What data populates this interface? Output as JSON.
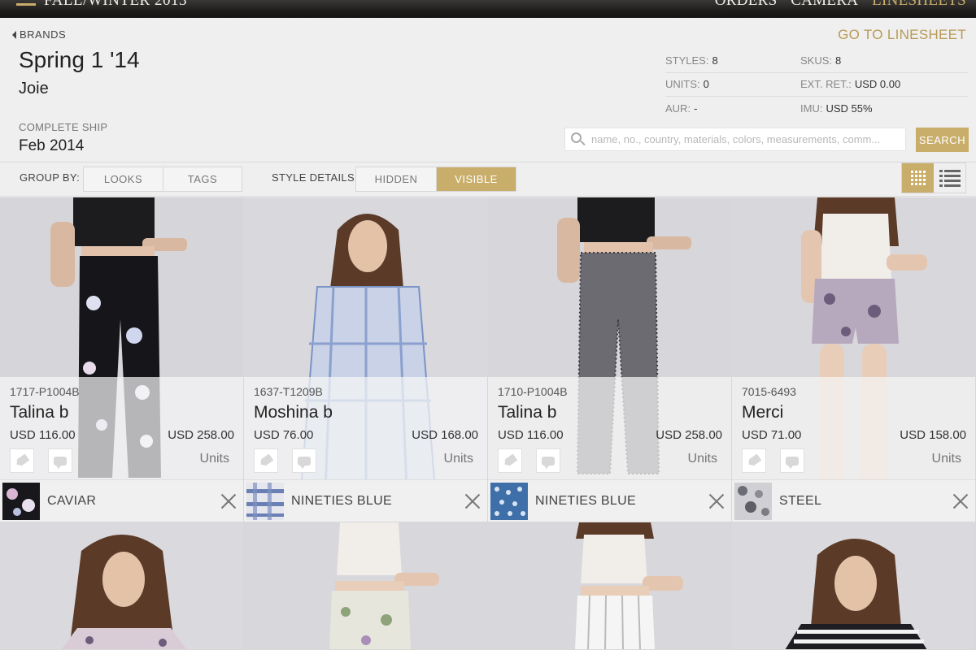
{
  "topbar": {
    "season": "FALL/WINTER 2013",
    "nav": [
      {
        "label": "ORDERS",
        "active": false
      },
      {
        "label": "CAMERA",
        "active": false
      },
      {
        "label": "LINESHEETS",
        "active": true
      }
    ]
  },
  "header": {
    "back_label": "BRANDS",
    "title": "Spring 1 '14",
    "brand": "Joie",
    "ship_label": "COMPLETE SHIP",
    "ship_value": "Feb 2014",
    "goto_label": "GO TO LINESHEET"
  },
  "stats": {
    "styles_label": "STYLES:",
    "styles_value": "8",
    "skus_label": "SKUS:",
    "skus_value": "8",
    "units_label": "UNITS:",
    "units_value": "0",
    "extret_label": "EXT. RET.:",
    "extret_value": "USD 0.00",
    "aur_label": "AUR:",
    "aur_value": "-",
    "imu_label": "IMU:",
    "imu_value": "USD 55%"
  },
  "search": {
    "placeholder": "name, no., country, materials, colors, measurements, comm...",
    "button_label": "SEARCH"
  },
  "toolbar": {
    "group_by_label": "GROUP BY:",
    "group_options": [
      {
        "label": "LOOKS",
        "active": false
      },
      {
        "label": "TAGS",
        "active": false
      }
    ],
    "style_details_label": "STYLE DETAILS:",
    "style_options": [
      {
        "label": "HIDDEN",
        "active": false
      },
      {
        "label": "VISIBLE",
        "active": true
      }
    ],
    "view_mode": "grid"
  },
  "products": [
    {
      "sku": "1717-P1004B",
      "name": "Talina b",
      "wholesale": "USD 116.00",
      "retail": "USD 258.00",
      "units_placeholder": "Units",
      "color": "CAVIAR"
    },
    {
      "sku": "1637-T1209B",
      "name": "Moshina b",
      "wholesale": "USD 76.00",
      "retail": "USD 168.00",
      "units_placeholder": "Units",
      "color": "NINETIES BLUE"
    },
    {
      "sku": "1710-P1004B",
      "name": "Talina b",
      "wholesale": "USD 116.00",
      "retail": "USD 258.00",
      "units_placeholder": "Units",
      "color": "NINETIES BLUE"
    },
    {
      "sku": "7015-6493",
      "name": "Merci",
      "wholesale": "USD 71.00",
      "retail": "USD 158.00",
      "units_placeholder": "Units",
      "color": "STEEL"
    }
  ],
  "colors": {
    "accent": "#c9ad6a",
    "accent_text": "#b99a55"
  }
}
